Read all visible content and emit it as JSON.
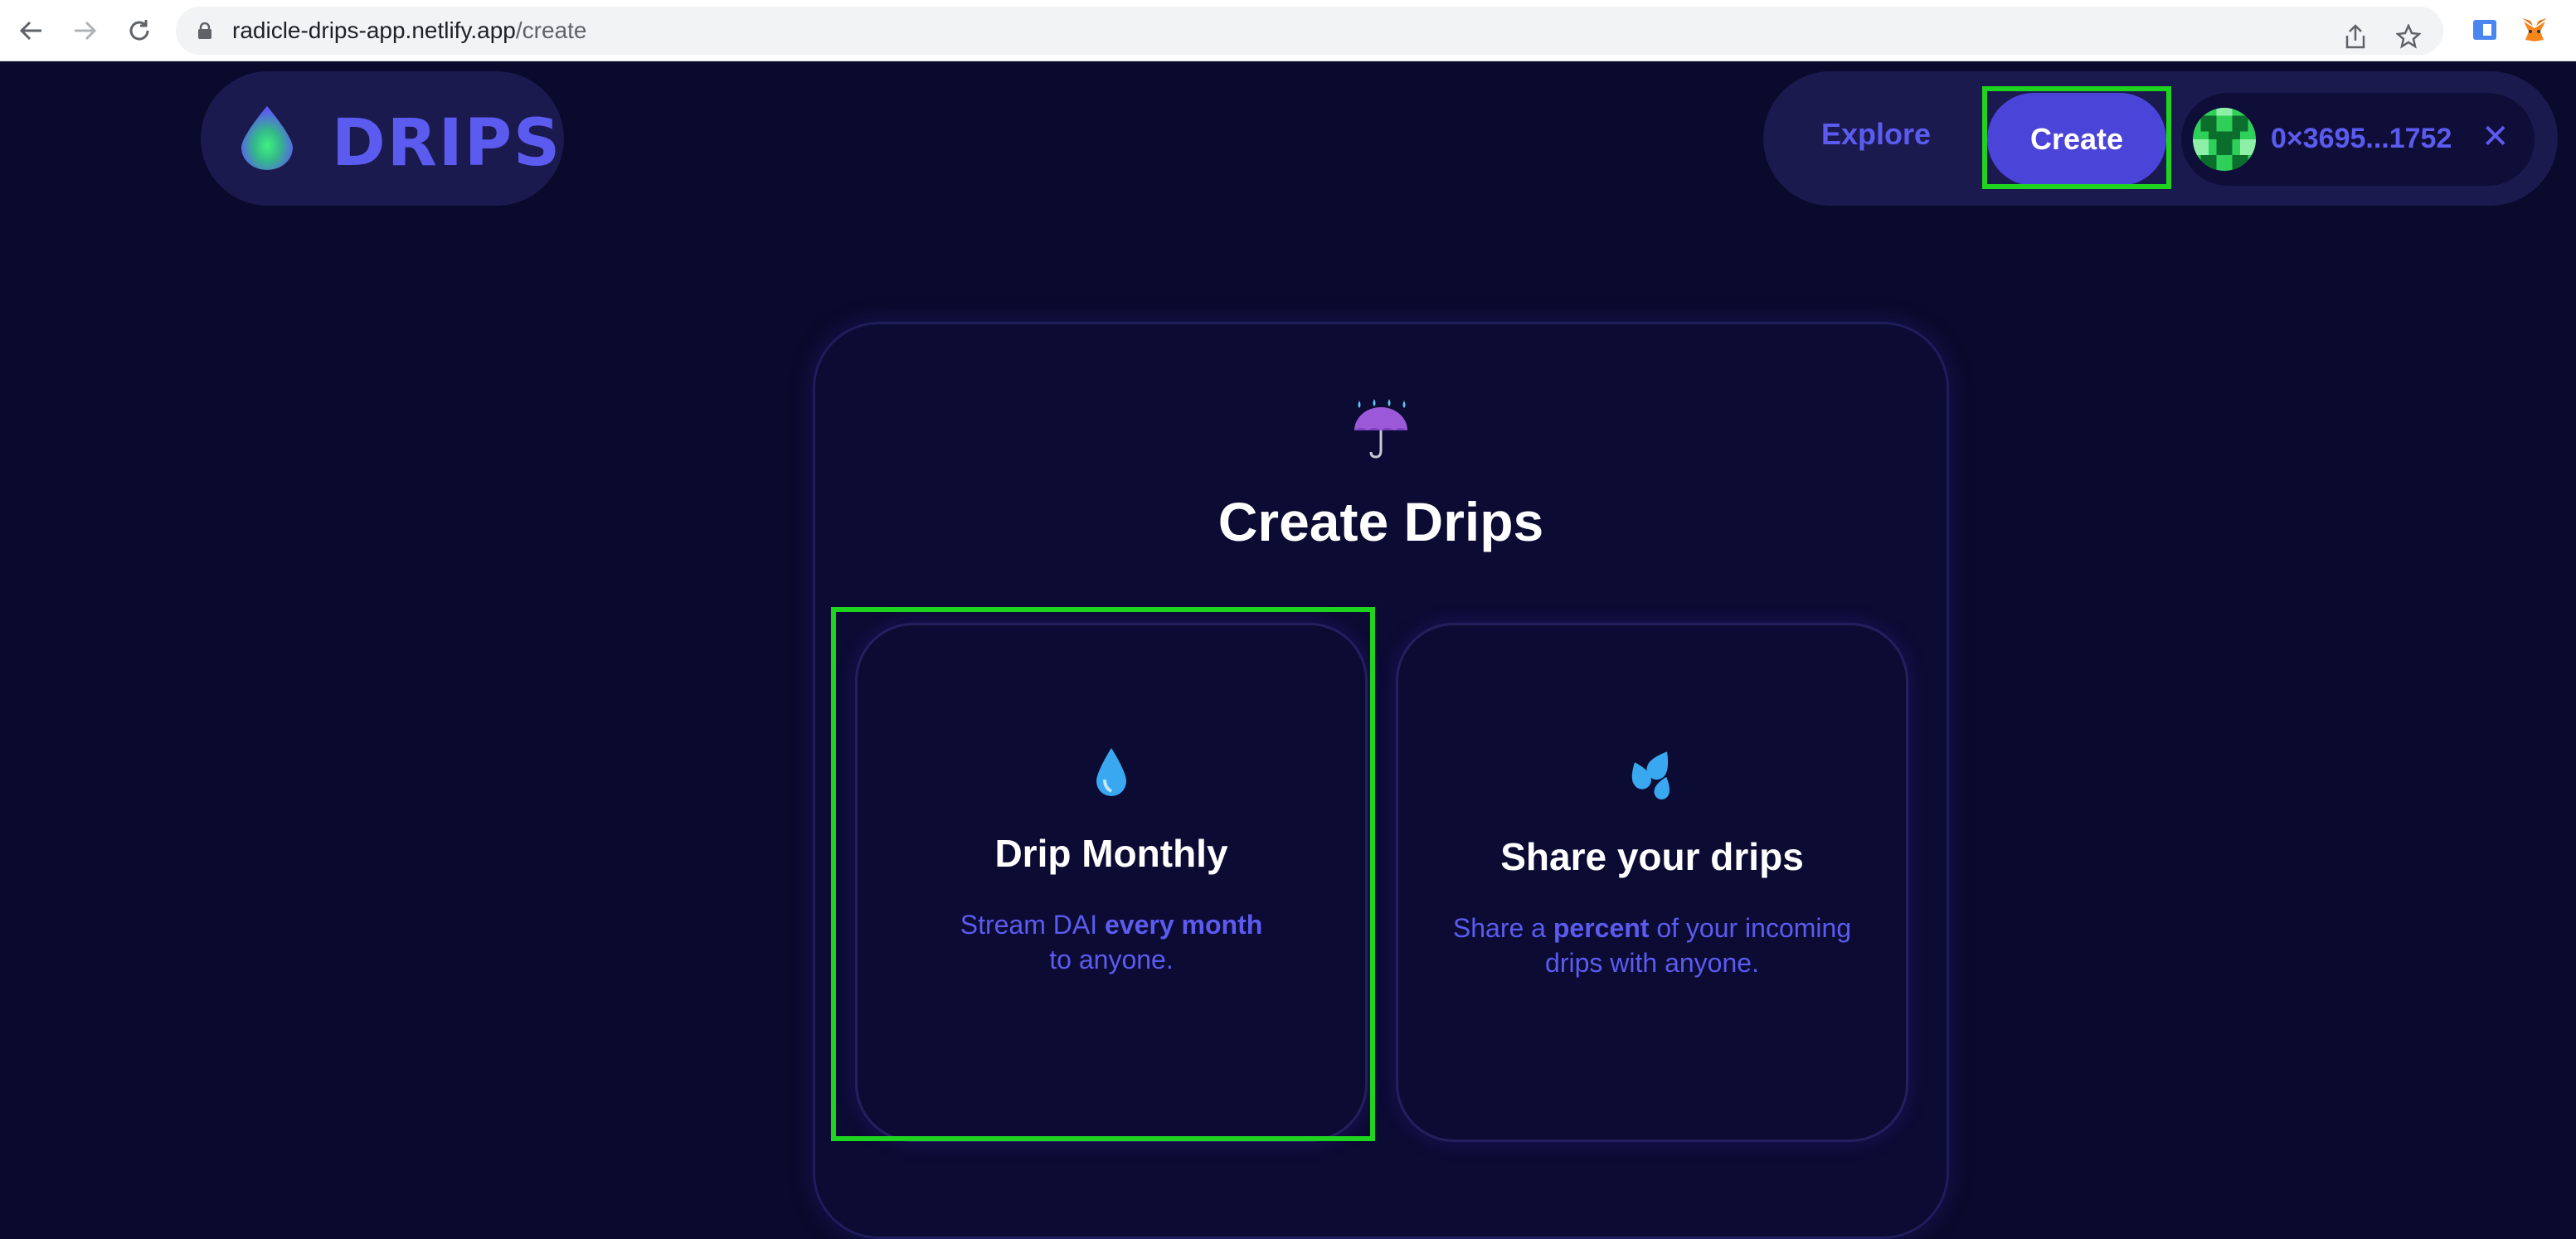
{
  "browser": {
    "url_host": "radicle-drips-app.netlify.app",
    "url_path": "/create"
  },
  "header": {
    "logo_text": "DRIPS",
    "nav": {
      "explore_label": "Explore",
      "create_label": "Create"
    },
    "wallet": {
      "address": "0×3695...1752",
      "disconnect_glyph": "✕"
    }
  },
  "main": {
    "title": "Create Drips",
    "options": [
      {
        "title": "Drip Monthly",
        "desc_pre": "Stream DAI ",
        "desc_bold": "every month",
        "desc_post": "to anyone."
      },
      {
        "title": "Share your drips",
        "desc_pre": "Share a ",
        "desc_bold": "percent",
        "desc_post": " of your incoming drips with anyone."
      }
    ]
  },
  "colors": {
    "background": "#0a0a2c",
    "accent": "#5b5bf0",
    "button": "#4b44d8",
    "highlight": "#1fd41f"
  }
}
